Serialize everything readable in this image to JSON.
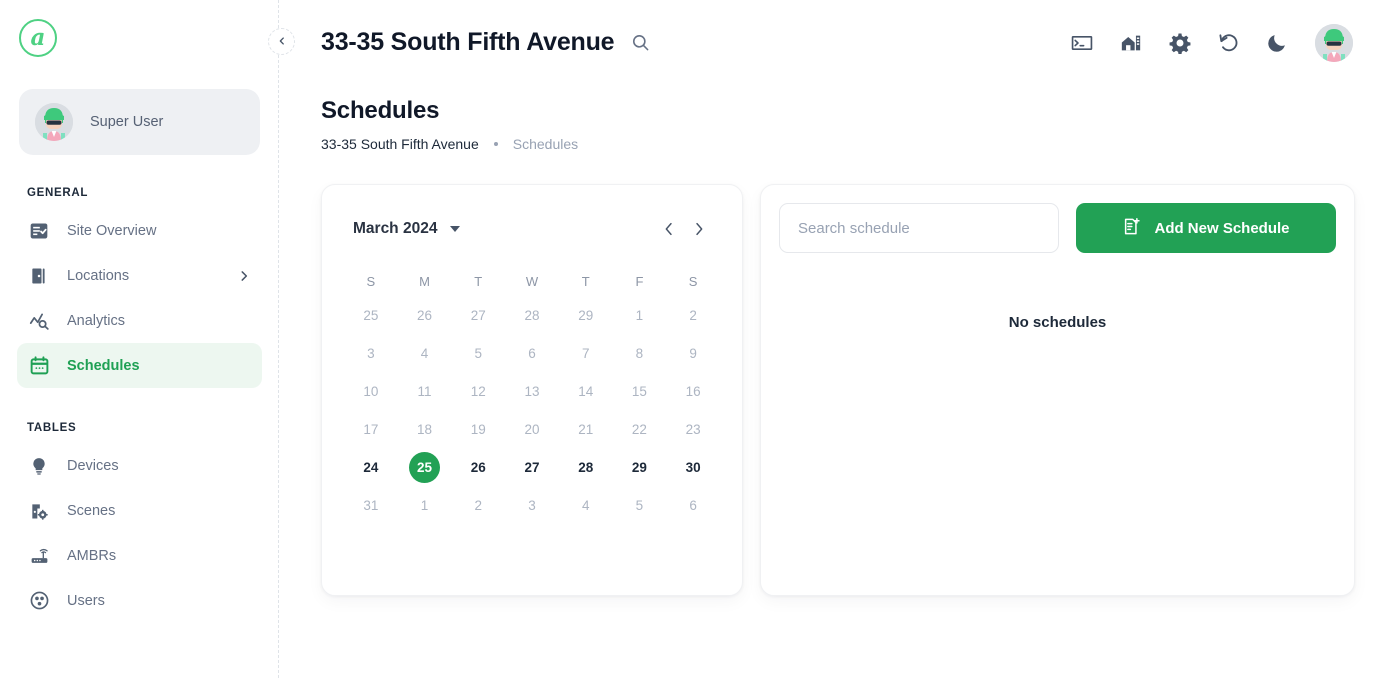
{
  "brand": {
    "logo_letter": "a",
    "accent_green": "#22a155",
    "logo_green": "#4ed183",
    "active_bg": "#edf7f0"
  },
  "sidebar": {
    "user": {
      "name": "Super User",
      "avatar": "user-avatar"
    },
    "collapse_icon": "chevron-left-icon",
    "sections": [
      {
        "title": "GENERAL",
        "items": [
          {
            "label": "Site Overview",
            "icon": "list-check-icon",
            "active": false,
            "chevron": false
          },
          {
            "label": "Locations",
            "icon": "door-icon",
            "active": false,
            "chevron": true
          },
          {
            "label": "Analytics",
            "icon": "analytics-search-icon",
            "active": false,
            "chevron": false
          },
          {
            "label": "Schedules",
            "icon": "calendar-icon",
            "active": true,
            "chevron": false
          }
        ]
      },
      {
        "title": "TABLES",
        "items": [
          {
            "label": "Devices",
            "icon": "bulb-icon",
            "active": false,
            "chevron": false
          },
          {
            "label": "Scenes",
            "icon": "scene-gear-icon",
            "active": false,
            "chevron": false
          },
          {
            "label": "AMBRs",
            "icon": "router-icon",
            "active": false,
            "chevron": false
          },
          {
            "label": "Users",
            "icon": "users-icon",
            "active": false,
            "chevron": false
          }
        ]
      }
    ]
  },
  "topbar": {
    "title": "33-35 South Fifth Avenue",
    "search_icon": "search-icon",
    "actions": [
      {
        "name": "terminal-icon"
      },
      {
        "name": "building-icon"
      },
      {
        "name": "gear-icon"
      },
      {
        "name": "refresh-icon"
      },
      {
        "name": "moon-icon"
      }
    ],
    "avatar": "user-avatar"
  },
  "page": {
    "title": "Schedules",
    "breadcrumb": {
      "site": "33-35 South Fifth Avenue",
      "current": "Schedules"
    }
  },
  "calendar": {
    "month_label": "March 2024",
    "prev_icon": "chevron-left-icon",
    "next_icon": "chevron-right-icon",
    "dropdown_icon": "caret-down-icon",
    "day_headers": [
      "S",
      "M",
      "T",
      "W",
      "T",
      "F",
      "S"
    ],
    "weeks": [
      [
        {
          "day": "25",
          "state": "muted"
        },
        {
          "day": "26",
          "state": "muted"
        },
        {
          "day": "27",
          "state": "muted"
        },
        {
          "day": "28",
          "state": "muted"
        },
        {
          "day": "29",
          "state": "muted"
        },
        {
          "day": "1",
          "state": "muted"
        },
        {
          "day": "2",
          "state": "muted"
        }
      ],
      [
        {
          "day": "3",
          "state": "muted"
        },
        {
          "day": "4",
          "state": "muted"
        },
        {
          "day": "5",
          "state": "muted"
        },
        {
          "day": "6",
          "state": "muted"
        },
        {
          "day": "7",
          "state": "muted"
        },
        {
          "day": "8",
          "state": "muted"
        },
        {
          "day": "9",
          "state": "muted"
        }
      ],
      [
        {
          "day": "10",
          "state": "muted"
        },
        {
          "day": "11",
          "state": "muted"
        },
        {
          "day": "12",
          "state": "muted"
        },
        {
          "day": "13",
          "state": "muted"
        },
        {
          "day": "14",
          "state": "muted"
        },
        {
          "day": "15",
          "state": "muted"
        },
        {
          "day": "16",
          "state": "muted"
        }
      ],
      [
        {
          "day": "17",
          "state": "muted"
        },
        {
          "day": "18",
          "state": "muted"
        },
        {
          "day": "19",
          "state": "muted"
        },
        {
          "day": "20",
          "state": "muted"
        },
        {
          "day": "21",
          "state": "muted"
        },
        {
          "day": "22",
          "state": "muted"
        },
        {
          "day": "23",
          "state": "muted"
        }
      ],
      [
        {
          "day": "24",
          "state": "enabled"
        },
        {
          "day": "25",
          "state": "selected"
        },
        {
          "day": "26",
          "state": "enabled"
        },
        {
          "day": "27",
          "state": "enabled"
        },
        {
          "day": "28",
          "state": "enabled"
        },
        {
          "day": "29",
          "state": "enabled"
        },
        {
          "day": "30",
          "state": "enabled"
        }
      ],
      [
        {
          "day": "31",
          "state": "muted"
        },
        {
          "day": "1",
          "state": "muted"
        },
        {
          "day": "2",
          "state": "muted"
        },
        {
          "day": "3",
          "state": "muted"
        },
        {
          "day": "4",
          "state": "muted"
        },
        {
          "day": "5",
          "state": "muted"
        },
        {
          "day": "6",
          "state": "muted"
        }
      ]
    ]
  },
  "schedules_panel": {
    "search_placeholder": "Search schedule",
    "search_value": "",
    "add_button_label": "Add New Schedule",
    "add_button_icon": "add-document-icon",
    "empty_message": "No schedules"
  }
}
